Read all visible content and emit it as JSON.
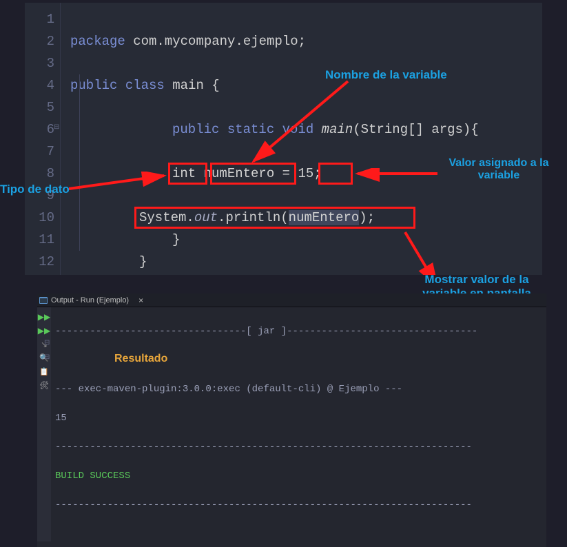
{
  "editor": {
    "line_numbers": [
      "1",
      "2",
      "3",
      "4",
      "5",
      "6",
      "7",
      "8",
      "9",
      "10",
      "11",
      "12"
    ],
    "code": {
      "l2_kw1": "package",
      "l2_id": " com.mycompany.ejemplo;",
      "l4_kw1": "public",
      "l4_kw2": " class",
      "l4_id": " main {",
      "l6_kw1": "public",
      "l6_kw2": " static",
      "l6_kw3": " void",
      "l6_m": " main",
      "l6_rest": "(String[] args){",
      "l8_type": "int",
      "l8_var": " numEntero",
      "l8_eq": " = ",
      "l8_val": "15;",
      "l10_sys": "System.",
      "l10_out": "out",
      "l10_pr": ".println(",
      "l10_arg": "numEntero",
      "l10_end": ");",
      "l11_close": "}",
      "l12_close": "}"
    }
  },
  "annotations": {
    "tipo_dato": "Tipo de dato",
    "nombre_var": "Nombre de la variable",
    "valor_asignado_l1": "Valor asignado a la",
    "valor_asignado_l2": "variable",
    "mostrar_l1": "Mostrar valor de la",
    "mostrar_l2": "variable en pantalla",
    "resultado": "Resultado"
  },
  "output": {
    "tab_title": "Output - Run (Ejemplo)",
    "jar_line_left": "---------------------------------[ ",
    "jar_text": "jar",
    "jar_line_right": " ]---------------------------------",
    "exec_line": "--- exec-maven-plugin:3.0.0:exec (default-cli) @ Ejemplo ---",
    "result_value": "15",
    "dash_line": "------------------------------------------------------------------------",
    "build_success": "BUILD SUCCESS",
    "dash_line2": "------------------------------------------------------------------------"
  },
  "icons": {
    "run_double": "▶▶",
    "run_one": "▶▶",
    "stop": "↘",
    "search": "🔍",
    "copy": "📋",
    "wrench": "🛠"
  }
}
